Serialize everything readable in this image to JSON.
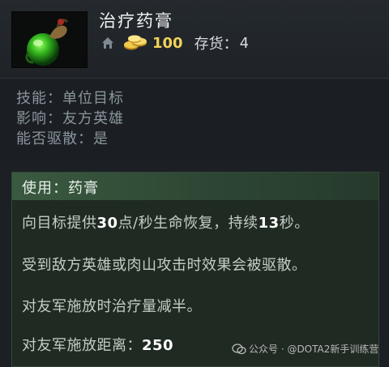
{
  "item": {
    "name": "治疗药膏",
    "cost": "100",
    "stock_label": "存货：",
    "stock_value": "4"
  },
  "attributes": [
    {
      "label": "技能：",
      "value": "单位目标"
    },
    {
      "label": "影响：",
      "value": "友方英雄"
    },
    {
      "label": "能否驱散：",
      "value": "是"
    }
  ],
  "use": {
    "title": "使用：药膏",
    "line1_prefix": "向目标提供",
    "line1_hp": "30",
    "line1_middle": "点/秒生命恢复，持续",
    "line1_duration": "13",
    "line1_suffix": "秒。",
    "line2": "受到敌方英雄或肉山攻击时效果会被驱散。",
    "line3": "对友军施放时治疗量减半。",
    "line4_label": "对友军施放距离：",
    "line4_value": "250"
  },
  "watermark": "公众号 · @DOTA2新手训练营",
  "colors": {
    "gold": "#f0d15a",
    "use_header": "#3a5a40",
    "background": "#1c2025"
  },
  "icons": [
    "healing-salve-item-icon",
    "home-icon",
    "gold-coins-icon"
  ]
}
